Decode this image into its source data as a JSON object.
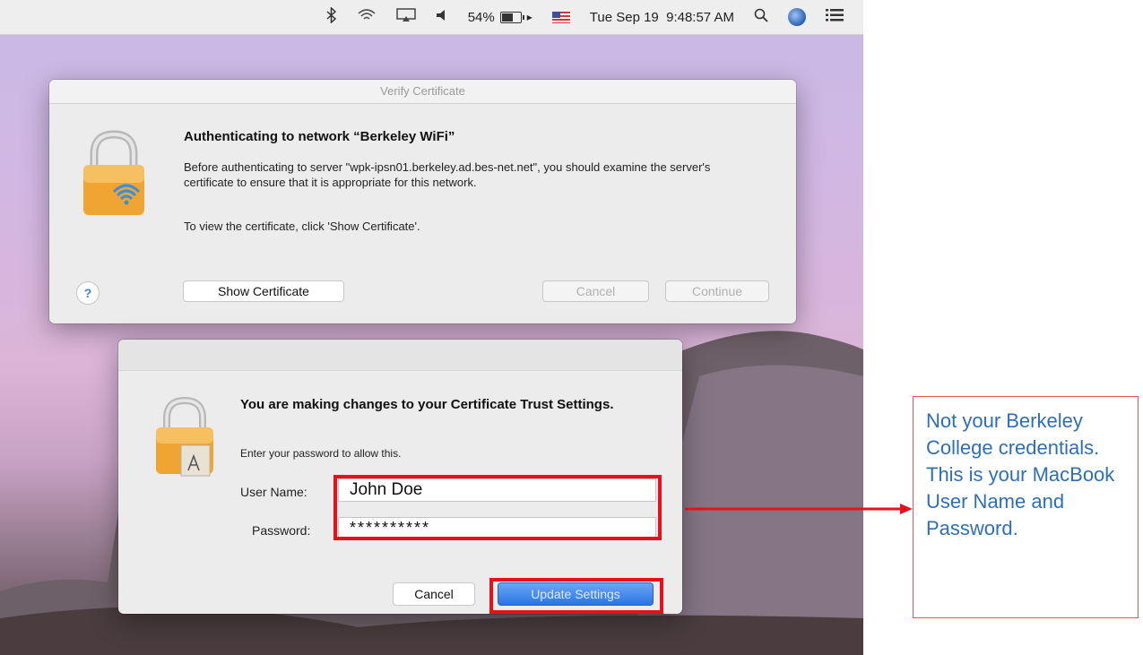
{
  "menubar": {
    "battery_percent": "54%",
    "battery_level": 0.54,
    "datetime": "Tue Sep 19  9:48:57 AM",
    "icons": [
      "bluetooth-icon",
      "wifi-icon",
      "airplay-icon",
      "volume-icon",
      "battery-icon",
      "flag-icon",
      "search-icon",
      "user-avatar-icon",
      "list-icon"
    ]
  },
  "dialog_verify": {
    "window_title": "Verify Certificate",
    "heading": "Authenticating to network “Berkeley WiFi”",
    "body": "Before authenticating to server \"wpk-ipsn01.berkeley.ad.bes-net.net\", you should examine the server's certificate to ensure that it is appropriate for this network.",
    "instruction": "To view the certificate, click 'Show Certificate'.",
    "help_label": "?",
    "show_certificate_label": "Show Certificate",
    "cancel_label": "Cancel",
    "continue_label": "Continue"
  },
  "dialog_trust": {
    "heading": "You are making changes to your Certificate Trust Settings.",
    "subtext": "Enter your password to allow this.",
    "username_label": "User Name:",
    "username_value": "John Doe",
    "password_label": "Password:",
    "password_value": "**********",
    "cancel_label": "Cancel",
    "update_label": "Update Settings"
  },
  "callout": {
    "text": "Not your Berkeley College credentials. This is your MacBook User Name and Password."
  },
  "colors": {
    "highlight": "#e8101a",
    "callout_text": "#2e6fb6",
    "accent_blue": "#2a74e3"
  }
}
